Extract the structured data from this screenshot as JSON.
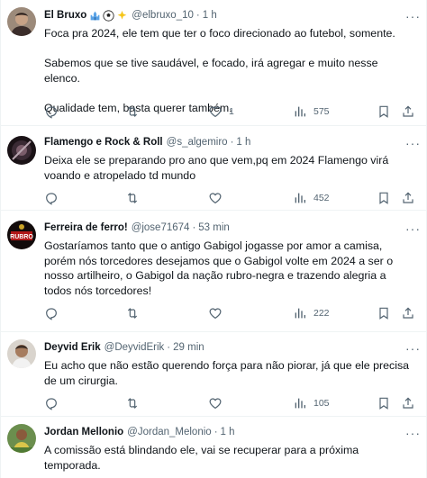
{
  "tweets": [
    {
      "name": "El Bruxo",
      "handle": "@elbruxo_10",
      "dot": "·",
      "time": "1 h",
      "lines": [
        "Foca pra 2024, ele tem que ter o foco direcionado ao futebol, somente.",
        "",
        "Sabemos que se tive saudável, e focado, irá agregar e muito nesse elenco.",
        "",
        "Qualidade tem, basta querer também."
      ],
      "likes": "1",
      "views": "575"
    },
    {
      "name": "Flamengo e Rock & Roll",
      "handle": "@s_algemiro",
      "dot": "·",
      "time": "1 h",
      "lines": [
        "Deixa ele se preparando pro ano que vem,pq em 2024 Flamengo virá voando e atropelado td mundo"
      ],
      "likes": "",
      "views": "452"
    },
    {
      "name": "Ferreira de ferro!",
      "handle": "@jose71674",
      "dot": "·",
      "time": "53 min",
      "lines": [
        "Gostaríamos tanto que o antigo Gabigol jogasse por amor a camisa, porém nós torcedores desejamos que o Gabigol volte em 2024 a ser o nosso artilheiro,  o Gabigol da nação rubro-negra e trazendo alegria a todos nós torcedores!"
      ],
      "likes": "",
      "views": "222"
    },
    {
      "name": "Deyvid Erik",
      "handle": "@DeyvidErik",
      "dot": "·",
      "time": "29 min",
      "lines": [
        "Eu acho que não estão querendo força para não piorar, já que ele precisa de um cirurgia."
      ],
      "likes": "",
      "views": "105"
    },
    {
      "name": "Jordan Mellonio",
      "handle": "@Jordan_Melonio",
      "dot": "·",
      "time": "1 h",
      "lines": [
        "A comissão está blindando ele, vai se recuperar para a próxima temporada."
      ],
      "likes": "",
      "views": ""
    }
  ],
  "icons": {
    "more": "more-dots-icon",
    "reply": "reply-icon",
    "retweet": "retweet-icon",
    "like": "heart-icon",
    "views": "views-chart-icon",
    "bookmark": "bookmark-icon",
    "share": "share-icon"
  },
  "colors": {
    "text": "#0f1419",
    "secondary": "#536471",
    "divider": "#eff3f4"
  }
}
